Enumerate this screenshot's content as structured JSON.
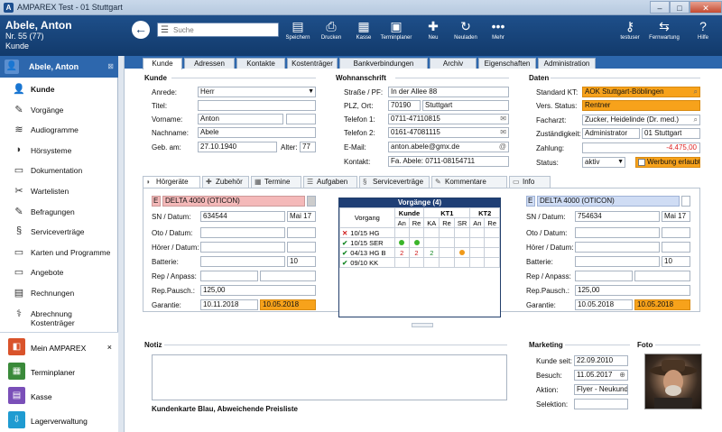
{
  "window": {
    "title": "AMPAREX Test - 01 Stuttgart",
    "minimize": "–",
    "maximize": "□",
    "close": "✕"
  },
  "patient": {
    "name": "Abele, Anton",
    "number": "Nr. 55 (77)",
    "type": "Kunde"
  },
  "search": {
    "placeholder": "Suche"
  },
  "toolbar": [
    {
      "label": "Speichern",
      "icon": "save-icon",
      "glyph": "▤"
    },
    {
      "label": "Drucken",
      "icon": "print-icon",
      "glyph": "⎙"
    },
    {
      "label": "Kasse",
      "icon": "cash-register-icon",
      "glyph": "▦"
    },
    {
      "label": "Terminplaner",
      "icon": "calendar-icon",
      "glyph": "▣"
    },
    {
      "label": "Neu",
      "icon": "new-document-icon",
      "glyph": "✚"
    },
    {
      "label": "Neuladen",
      "icon": "reload-icon",
      "glyph": "↻"
    },
    {
      "label": "Mehr",
      "icon": "more-icon",
      "glyph": "•••"
    }
  ],
  "toolbar_right": [
    {
      "label": "testuser",
      "icon": "key-icon",
      "glyph": "⚷"
    },
    {
      "label": "Fernwartung",
      "icon": "remote-icon",
      "glyph": "⇆"
    },
    {
      "label": "Hilfe",
      "icon": "help-icon",
      "glyph": "?"
    }
  ],
  "sidebar": {
    "active": "Abele, Anton",
    "items": [
      "Kunde",
      "Vorgänge",
      "Audiogramme",
      "Hörsysteme",
      "Dokumentation",
      "Wartelisten",
      "Befragungen",
      "Serviceverträge",
      "Karten und Programme",
      "Angebote",
      "Rechnungen",
      "Abrechnung Kostenträger"
    ],
    "icons": [
      "👤",
      "✎",
      "≋",
      "◗",
      "▭",
      "✂",
      "✎",
      "§",
      "▭",
      "▭",
      "▤",
      "⚕"
    ],
    "bottom": [
      {
        "label": "Mein AMPAREX",
        "glyph": "◧",
        "color": "#d9532b"
      },
      {
        "label": "Terminplaner",
        "glyph": "▦",
        "color": "#3a8a3a"
      },
      {
        "label": "Kasse",
        "glyph": "▤",
        "color": "#7a4fb8"
      },
      {
        "label": "Lagerverwaltung",
        "glyph": "⇩",
        "color": "#1f9bd1"
      }
    ],
    "bottom_close": "×"
  },
  "tabs": [
    "Kunde",
    "Adressen",
    "Kontakte",
    "Kostenträger",
    "Bankverbindungen",
    "Archiv",
    "Eigenschaften",
    "Administration"
  ],
  "kunde": {
    "section": "Kunde",
    "anrede_label": "Anrede:",
    "anrede": "Herr",
    "titel_label": "Titel:",
    "titel": "",
    "vorname_label": "Vorname:",
    "vorname": "Anton",
    "nachname_label": "Nachname:",
    "nachname": "Abele",
    "geb_label": "Geb. am:",
    "geb": "27.10.1940",
    "alter_label": "Alter:",
    "alter": "77"
  },
  "wohnanschrift": {
    "section": "Wohnanschrift",
    "strasse_label": "Straße / PF:",
    "strasse": "In der Allee 88",
    "plz_label": "PLZ, Ort:",
    "plz": "70190",
    "ort": "Stuttgart",
    "tel1_label": "Telefon 1:",
    "tel1": "0711-47110815",
    "tel2_label": "Telefon 2:",
    "tel2": "0161-47081115",
    "email_label": "E-Mail:",
    "email": "anton.abele@gmx.de",
    "kontakt_label": "Kontakt:",
    "kontakt": "Fa. Abele: 0711-08154711"
  },
  "daten": {
    "section": "Daten",
    "kt_label": "Standard KT:",
    "kt": "AOK Stuttgart-Böblingen",
    "vers_label": "Vers. Status:",
    "vers": "Rentner",
    "facharzt_label": "Facharzt:",
    "facharzt": "Zucker, Heidelinde (Dr. med.)",
    "zust_label": "Zuständigkeit:",
    "zust": "Administrator",
    "filiale": "01 Stuttgart",
    "zahlung_label": "Zahlung:",
    "zahlung": "-4.475,00",
    "status_label": "Status:",
    "status": "aktiv",
    "werbung": "Werbung erlaubt"
  },
  "subtabs": [
    "Hörgeräte",
    "Zubehör",
    "Termine",
    "Aufgaben",
    "Serviceverträge",
    "Kommentare",
    "Info"
  ],
  "subtab_icons": [
    "◗",
    "✚",
    "▦",
    "☰",
    "§",
    "✎",
    "▭"
  ],
  "left_device": {
    "e": "E",
    "device": "DELTA 4000 (OTICON)",
    "sn_label": "SN / Datum:",
    "sn": "634544",
    "sn_date": "Mai 17",
    "oto_label": "Oto / Datum:",
    "hoerer_label": "Hörer / Datum:",
    "batterie_label": "Batterie:",
    "batterie": "10",
    "rep_label": "Rep / Anpass:",
    "pausch_label": "Rep.Pausch.:",
    "pausch": "125,00",
    "garantie_label": "Garantie:",
    "garantie1": "10.11.2018",
    "garantie2": "10.05.2018"
  },
  "right_device": {
    "e": "E",
    "device": "DELTA 4000 (OTICON)",
    "sn_label": "SN / Datum:",
    "sn": "754634",
    "sn_date": "Mai 17",
    "oto_label": "Oto / Datum:",
    "hoerer_label": "Hörer / Datum:",
    "batterie_label": "Batterie:",
    "batterie": "10",
    "rep_label": "Rep / Anpass:",
    "pausch_label": "Rep.Pausch.:",
    "pausch": "125,00",
    "garantie_label": "Garantie:",
    "garantie1": "10.05.2018",
    "garantie2": "10.05.2018"
  },
  "vorgaenge": {
    "title": "Vorgänge (4)",
    "col_vorgang": "Vorgang",
    "grp_kunde": "Kunde",
    "grp_kt1": "KT1",
    "grp_kt2": "KT2",
    "sub": [
      "An",
      "Re",
      "KA",
      "Re",
      "SR",
      "An",
      "Re"
    ],
    "rows": [
      {
        "mark": "✕",
        "name": "10/15 HG"
      },
      {
        "mark": "✔",
        "name": "10/15 SER"
      },
      {
        "mark": "✔",
        "name": "04/13 HG  B",
        "v1": "2",
        "v2": "2",
        "v3": "2"
      },
      {
        "mark": "✔",
        "name": "09/10 KK"
      }
    ]
  },
  "notiz": {
    "section": "Notiz",
    "text": "Kundenkarte Blau, Abweichende Preisliste"
  },
  "marketing": {
    "section": "Marketing",
    "seit_label": "Kunde seit:",
    "seit": "22.09.2010",
    "besuch_label": "Besuch:",
    "besuch": "11.05.2017",
    "aktion_label": "Aktion:",
    "aktion": "Flyer - Neukunde",
    "selektion_label": "Selektion:",
    "selektion": ""
  },
  "foto": {
    "section": "Foto"
  },
  "colors": {
    "header": "#1e4f8a",
    "accent": "#2d67ad",
    "orange": "#f7a21b",
    "red": "#d22"
  }
}
